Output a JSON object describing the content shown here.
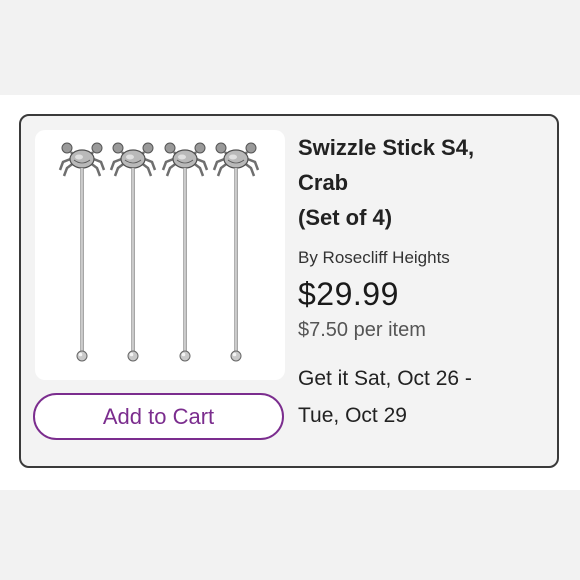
{
  "product": {
    "title_lines": [
      "Swizzle Stick S4,",
      "Crab",
      "(Set of 4)"
    ],
    "brand": "By Rosecliff Heights",
    "price": "$29.99",
    "unit_price": "$7.50 per item",
    "delivery_lines": [
      "Get it Sat, Oct 26 -",
      "Tue, Oct 29"
    ],
    "image_icon": "crab-swizzle-sticks-image"
  },
  "actions": {
    "add_to_cart_label": "Add to Cart"
  },
  "colors": {
    "accent": "#7b2d8e",
    "card_bg": "#f3f3f3",
    "card_border": "#3a3a3a"
  }
}
